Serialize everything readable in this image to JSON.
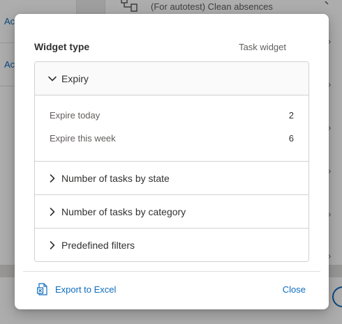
{
  "background": {
    "left_items": [
      "Ac",
      "Ac"
    ],
    "top_item_text": "(For autotest) Clean absences"
  },
  "dialog": {
    "title": "Widget type",
    "widget_type": "Task widget",
    "sections": [
      {
        "label": "Expiry",
        "expanded": true,
        "rows": [
          {
            "label": "Expire today",
            "count": "2"
          },
          {
            "label": "Expire this week",
            "count": "6"
          }
        ]
      },
      {
        "label": "Number of tasks by state",
        "expanded": false
      },
      {
        "label": "Number of tasks by category",
        "expanded": false
      },
      {
        "label": "Predefined filters",
        "expanded": false
      }
    ],
    "footer": {
      "export_label": "Export to Excel",
      "export_icon": "excel-icon",
      "close_label": "Close"
    }
  },
  "colors": {
    "accent": "#0f6cbd",
    "text": "#323130",
    "muted": "#605e5c",
    "border": "#d1d1d1"
  }
}
